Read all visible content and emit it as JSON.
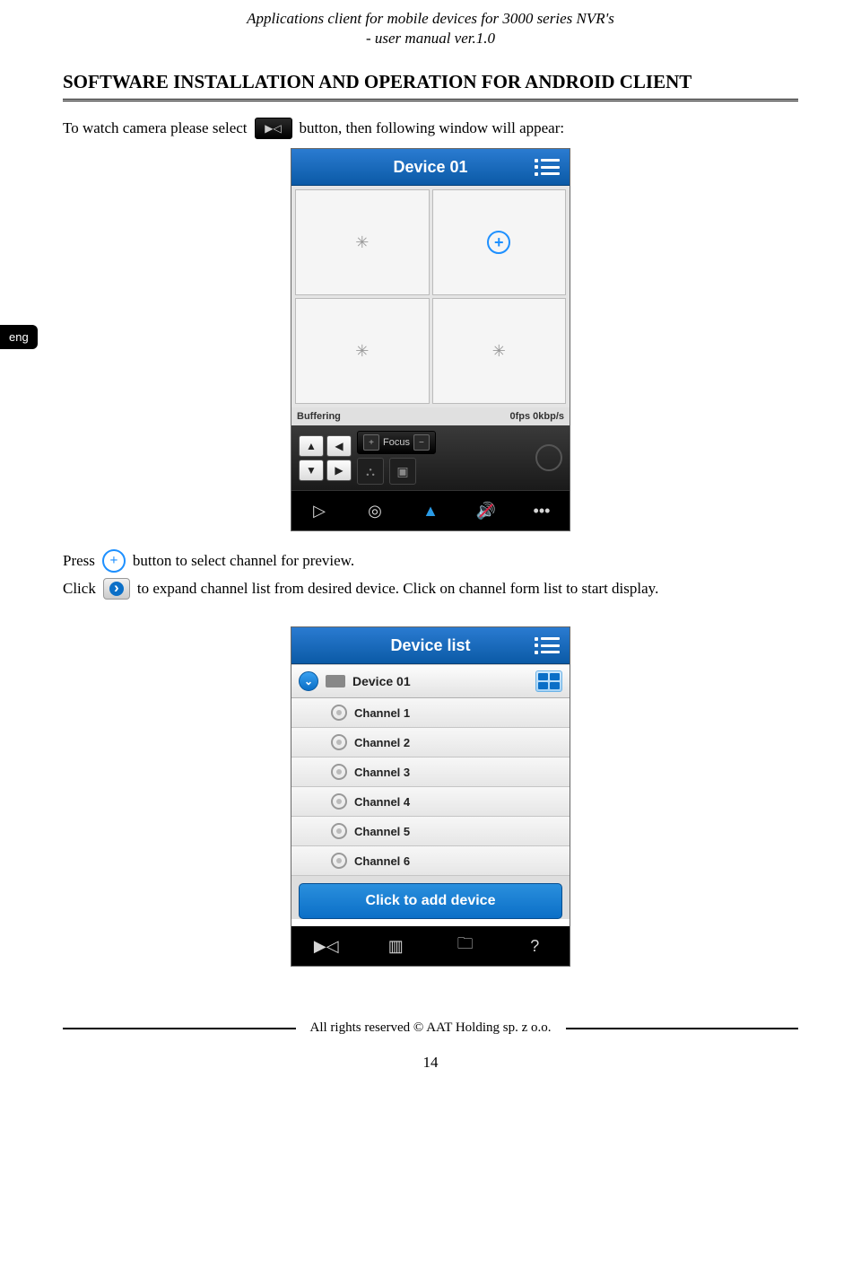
{
  "header": {
    "line1": "Applications client for mobile devices for 3000 series NVR's",
    "line2": "- user manual ver.1.0"
  },
  "section_heading": "SOFTWARE INSTALLATION AND OPERATION FOR ANDROID CLIENT",
  "lang_tab": "eng",
  "para1": {
    "before": "To watch camera please select",
    "after": "button, then following window will appear:"
  },
  "screenshot1": {
    "title": "Device 01",
    "status_left": "Buffering",
    "status_right": "0fps  0kbp/s",
    "focus_label": "Focus"
  },
  "para2": {
    "before": "Press",
    "after": "button to select channel for preview."
  },
  "para3": {
    "before": "Click",
    "after": "to expand channel list from desired device. Click on channel form list to start display."
  },
  "screenshot2": {
    "title": "Device list",
    "device_name": "Device 01",
    "channels": [
      "Channel 1",
      "Channel 2",
      "Channel 3",
      "Channel 4",
      "Channel 5",
      "Channel 6"
    ],
    "add_button": "Click to add device"
  },
  "footer": "All rights reserved © AAT Holding sp. z o.o.",
  "page_number": "14"
}
